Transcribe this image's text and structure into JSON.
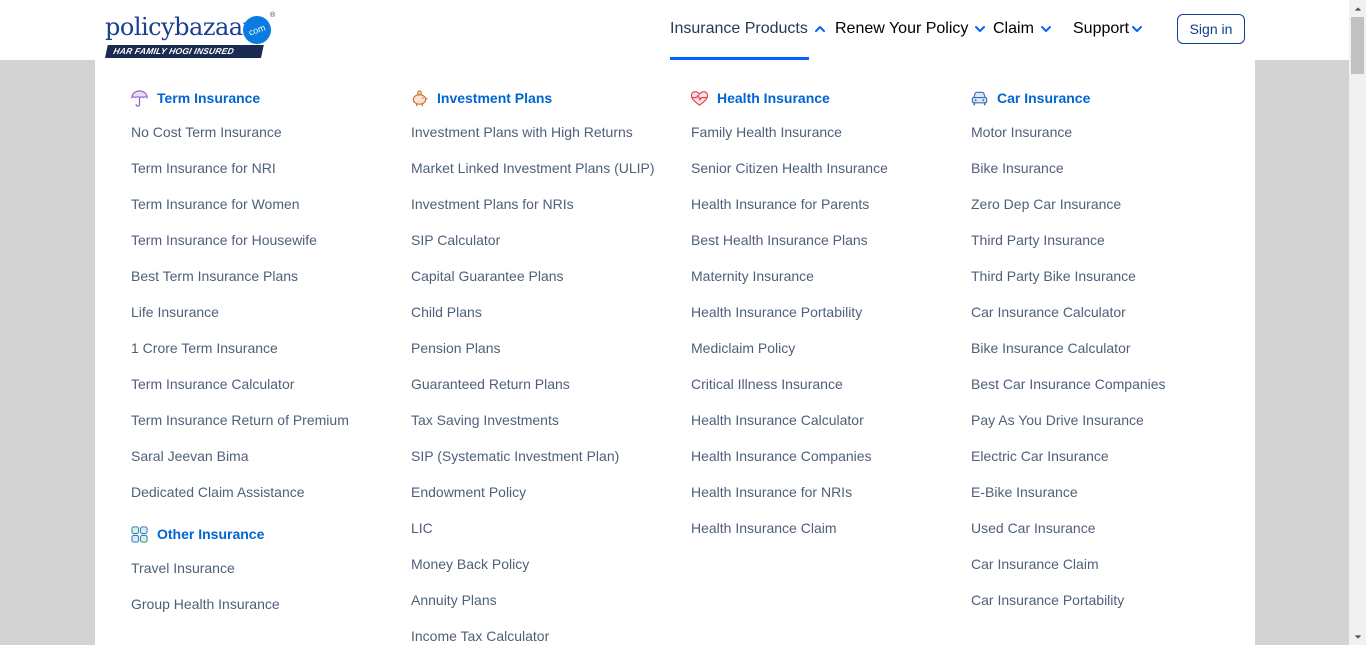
{
  "logo": {
    "word": "policybazaar",
    "com": "com",
    "reg": "®",
    "tagline": "HAR FAMILY HOGI INSURED"
  },
  "nav": {
    "items": [
      {
        "label": "Insurance Products",
        "icon": "chevron-up-icon",
        "active": true
      },
      {
        "label": "Renew Your Policy",
        "icon": "chevron-down-icon"
      },
      {
        "label": "Claim",
        "icon": "chevron-down-icon"
      },
      {
        "label": "Support",
        "icon": "chevron-down-icon"
      }
    ],
    "signin": "Sign in"
  },
  "colors": {
    "accent": "#0065ff",
    "heading": "#0065d1",
    "link": "#505f79",
    "brand": "#1a3f8f",
    "overlay": "#d3d3d3"
  },
  "menu": {
    "term": {
      "title": "Term Insurance",
      "icon": "umbrella-icon",
      "links": [
        "No Cost Term Insurance",
        "Term Insurance for NRI",
        "Term Insurance for Women",
        "Term Insurance for Housewife",
        "Best Term Insurance Plans",
        "Life Insurance",
        "1 Crore Term Insurance",
        "Term Insurance Calculator",
        "Term Insurance Return of Premium",
        "Saral Jeevan Bima",
        "Dedicated Claim Assistance"
      ]
    },
    "other": {
      "title": "Other Insurance",
      "icon": "grid-icon",
      "links": [
        "Travel Insurance",
        "Group Health Insurance"
      ]
    },
    "investment": {
      "title": "Investment Plans",
      "icon": "piggy-bank-icon",
      "links": [
        "Investment Plans with High Returns",
        "Market Linked Investment Plans (ULIP)",
        "Investment Plans for NRIs",
        "SIP Calculator",
        "Capital Guarantee Plans",
        "Child Plans",
        "Pension Plans",
        "Guaranteed Return Plans",
        "Tax Saving Investments",
        "SIP (Systematic Investment Plan)",
        "Endowment Policy",
        "LIC",
        "Money Back Policy",
        "Annuity Plans",
        "Income Tax Calculator"
      ]
    },
    "health": {
      "title": "Health Insurance",
      "icon": "heart-pulse-icon",
      "links": [
        "Family Health Insurance",
        "Senior Citizen Health Insurance",
        "Health Insurance for Parents",
        "Best Health Insurance Plans",
        "Maternity Insurance",
        "Health Insurance Portability",
        "Mediclaim Policy",
        "Critical Illness Insurance",
        "Health Insurance Calculator",
        "Health Insurance Companies",
        "Health Insurance for NRIs",
        "Health Insurance Claim"
      ]
    },
    "car": {
      "title": "Car Insurance",
      "icon": "car-icon",
      "links": [
        "Motor Insurance",
        "Bike Insurance",
        "Zero Dep Car Insurance",
        "Third Party Insurance",
        "Third Party Bike Insurance",
        "Car Insurance Calculator",
        "Bike Insurance Calculator",
        "Best Car Insurance Companies",
        "Pay As You Drive Insurance",
        "Electric Car Insurance",
        "E-Bike Insurance",
        "Used Car Insurance",
        "Car Insurance Claim",
        "Car Insurance Portability"
      ]
    }
  }
}
